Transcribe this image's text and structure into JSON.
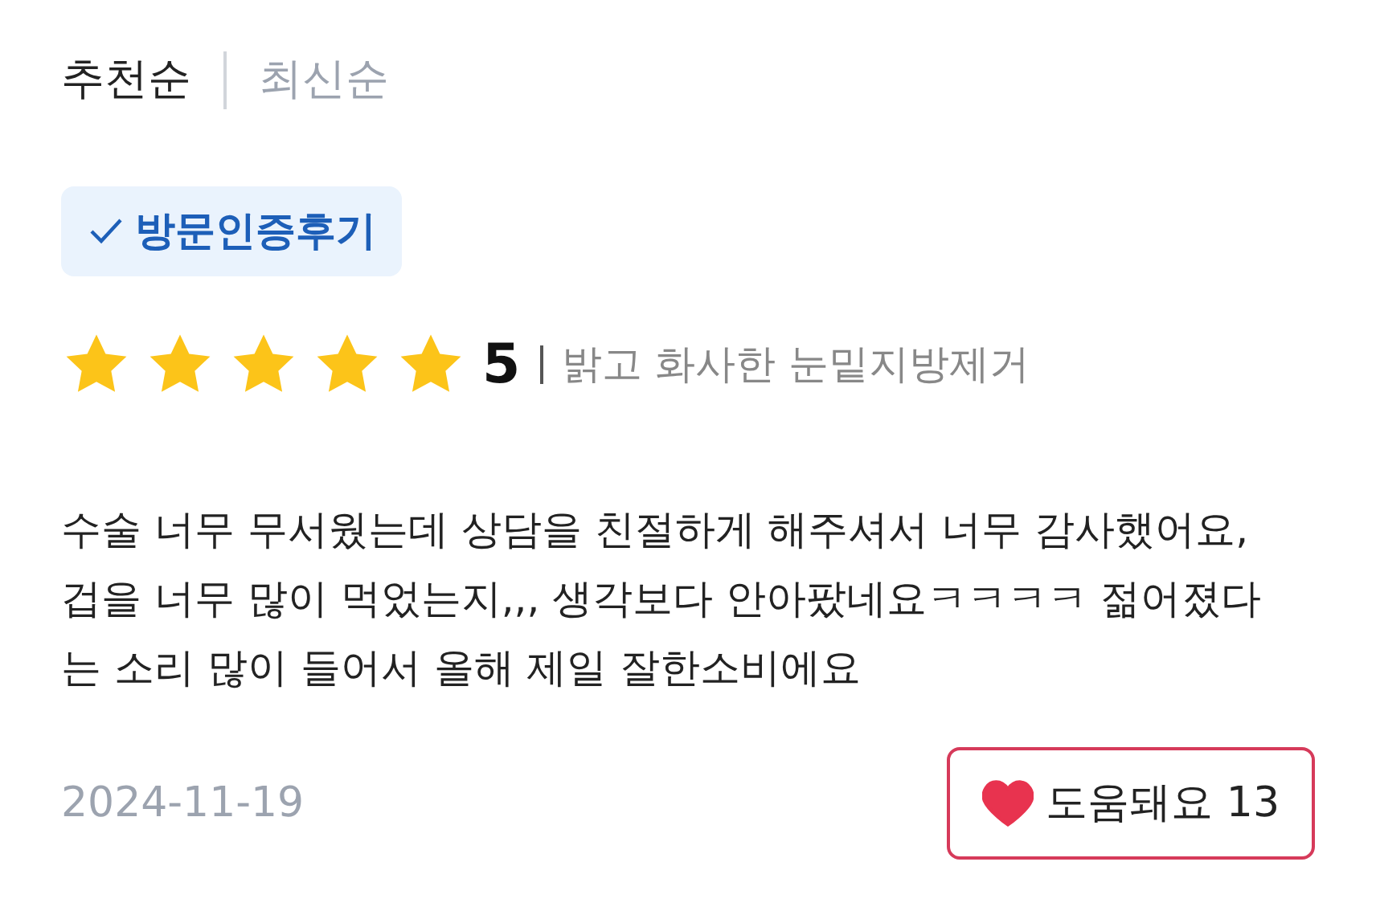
{
  "sort_tabs": [
    {
      "label": "추천순",
      "selected": true
    },
    {
      "label": "최신순",
      "selected": false
    }
  ],
  "badge": {
    "label": "방문인증후기"
  },
  "rating": {
    "stars": 5,
    "score": "5",
    "treatment": "밝고 화사한 눈밑지방제거"
  },
  "review": {
    "text": "수술 너무 무서웠는데 상담을 친절하게 해주셔서 너무 감사했어요, 겁을 너무 많이 먹었는지,,, 생각보다 안아팠네요ㅋㅋㅋㅋ 젊어졌다는 소리 많이 들어서 올해 제일 잘한소비에요"
  },
  "date": "2024-11-19",
  "helpful_button": {
    "label": "도움돼요",
    "count": "13",
    "liked": true
  }
}
